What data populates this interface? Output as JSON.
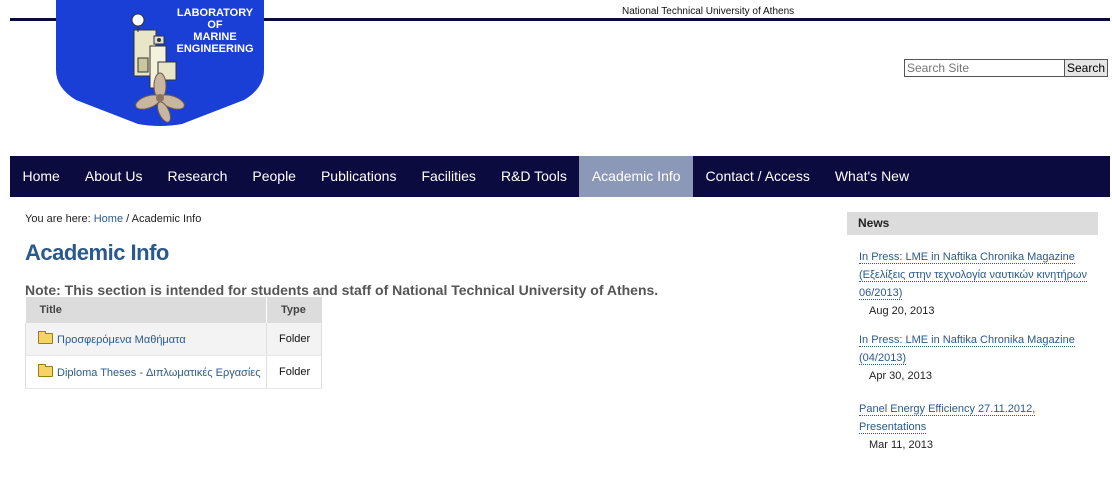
{
  "header": {
    "university": "National Technical University of Athens",
    "logo_lines": [
      "LABORATORY",
      "OF",
      "MARINE",
      "ENGINEERING"
    ]
  },
  "search": {
    "placeholder": "Search Site",
    "button_label": "Search"
  },
  "nav": {
    "items": [
      {
        "label": "Home",
        "active": false
      },
      {
        "label": "About Us",
        "active": false
      },
      {
        "label": "Research",
        "active": false
      },
      {
        "label": "People",
        "active": false
      },
      {
        "label": "Publications",
        "active": false
      },
      {
        "label": "Facilities",
        "active": false
      },
      {
        "label": "R&D Tools",
        "active": false
      },
      {
        "label": "Academic Info",
        "active": true
      },
      {
        "label": "Contact / Access",
        "active": false
      },
      {
        "label": "What's New",
        "active": false
      }
    ]
  },
  "breadcrumb": {
    "prefix": "You are here:",
    "home": "Home",
    "separator": "/",
    "current": "Academic Info"
  },
  "page": {
    "title": "Academic Info",
    "note": "Note: This section is intended for students and staff of National Technical University of Athens."
  },
  "listing": {
    "headers": {
      "title": "Title",
      "type": "Type"
    },
    "rows": [
      {
        "title": "Προσφερόμενα Μαθήματα",
        "type": "Folder",
        "icon": "folder-icon"
      },
      {
        "title": "Diploma Theses - Διπλωματικές Εργασίες",
        "type": "Folder",
        "icon": "folder-icon"
      }
    ]
  },
  "news": {
    "header": "News",
    "items": [
      {
        "title": "In Press: LME in Naftika Chronika Magazine (Εξελίξεις στην τεχνολογία ναυτικών κινητήρων 06/2013)",
        "date": "Aug 20, 2013"
      },
      {
        "title": "In Press: LME in Naftika Chronika Magazine (04/2013)",
        "date": "Apr 30, 2013"
      },
      {
        "title": "Panel Energy Efficiency 27.11.2012, Presentations",
        "date": "Mar 11, 2013"
      }
    ]
  },
  "colors": {
    "nav_bg": "#0b0b40",
    "nav_active": "#8c98b8",
    "link": "#2a5a8c",
    "logo_blue": "#1a3fd6"
  }
}
